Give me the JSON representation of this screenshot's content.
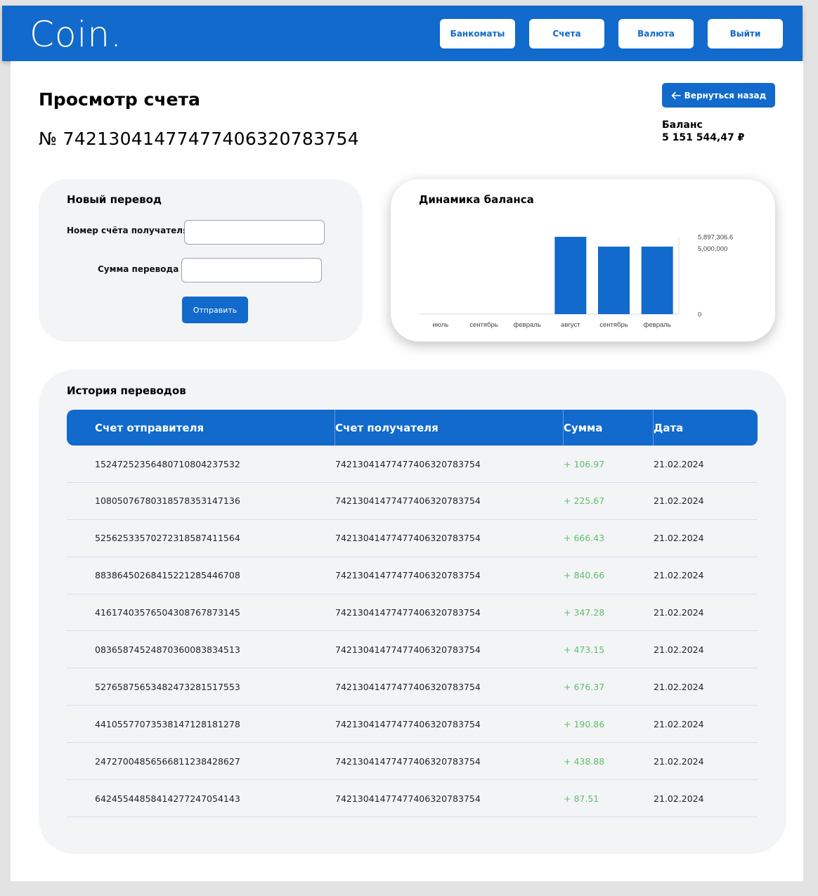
{
  "header": {
    "logo": "Coin.",
    "nav": [
      "Банкоматы",
      "Счета",
      "Валюта",
      "Выйти"
    ]
  },
  "page": {
    "title": "Просмотр счета",
    "account_number": "№ 74213041477477406320783754",
    "back_button": "Вернуться назад",
    "balance_label": "Баланс",
    "balance_value": "5 151 544,47 ₽"
  },
  "transfer": {
    "title": "Новый перевод",
    "recipient_label": "Номер счёта получателя",
    "recipient_value": "",
    "amount_label": "Сумма перевода",
    "amount_value": "",
    "submit_label": "Отправить"
  },
  "chart_data": {
    "type": "bar",
    "title": "Динамика баланса",
    "categories": [
      "июль",
      "сентябрь",
      "февраль",
      "август",
      "сентябрь",
      "февраль"
    ],
    "values": [
      0,
      0,
      0,
      5897306.6,
      5151544.47,
      5151544.47
    ],
    "ylim": [
      0,
      5897306.6
    ],
    "y_ticks": [
      "5,897,306.6",
      "5,000,000",
      "0"
    ],
    "y_tick_values": [
      5897306.6,
      5000000,
      0
    ],
    "bar_color": "#116acc"
  },
  "history": {
    "title": "История переводов",
    "columns": [
      "Счет отправителя",
      "Счет получателя",
      "Сумма",
      "Дата"
    ],
    "rows": [
      {
        "from": "15247252356480710804237532",
        "to": "74213041477477406320783754",
        "amount": "+ 106.97",
        "date": "21.02.2024"
      },
      {
        "from": "10805076780318578353147136",
        "to": "74213041477477406320783754",
        "amount": "+ 225.67",
        "date": "21.02.2024"
      },
      {
        "from": "52562533570272318587411564",
        "to": "74213041477477406320783754",
        "amount": "+ 666.43",
        "date": "21.02.2024"
      },
      {
        "from": "88386450268415221285446708",
        "to": "74213041477477406320783754",
        "amount": "+ 840.66",
        "date": "21.02.2024"
      },
      {
        "from": "41617403576504308767873145",
        "to": "74213041477477406320783754",
        "amount": "+ 347.28",
        "date": "21.02.2024"
      },
      {
        "from": "08365874524870360083834513",
        "to": "74213041477477406320783754",
        "amount": "+ 473.15",
        "date": "21.02.2024"
      },
      {
        "from": "52765875653482473281517553",
        "to": "74213041477477406320783754",
        "amount": "+ 676.37",
        "date": "21.02.2024"
      },
      {
        "from": "44105577073538147128181278",
        "to": "74213041477477406320783754",
        "amount": "+ 190.86",
        "date": "21.02.2024"
      },
      {
        "from": "24727004856566811238428627",
        "to": "74213041477477406320783754",
        "amount": "+ 438.88",
        "date": "21.02.2024"
      },
      {
        "from": "64245544858414277247054143",
        "to": "74213041477477406320783754",
        "amount": "+ 87.51",
        "date": "21.02.2024"
      }
    ],
    "amount_color": "#5fbf6a"
  },
  "colors": {
    "primary": "#116acc",
    "background": "#e3e3e3",
    "card": "#f3f4f6"
  }
}
